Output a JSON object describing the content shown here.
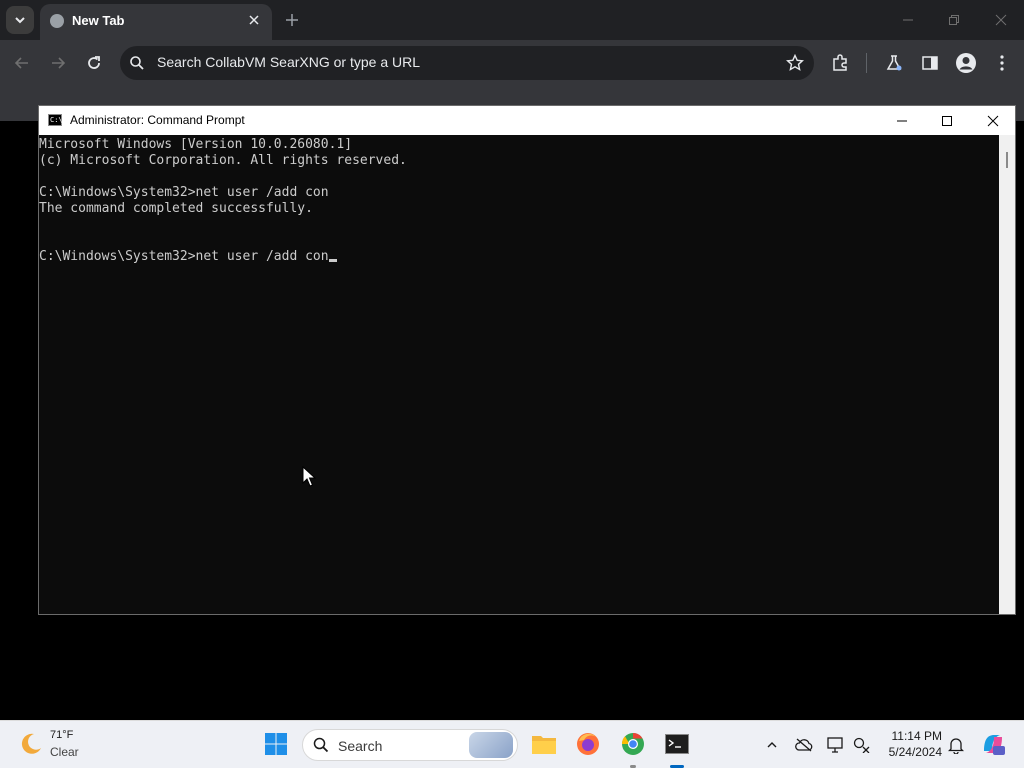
{
  "browser": {
    "tab_title": "New Tab",
    "omnibox_placeholder": "Search CollabVM SearXNG or type a URL"
  },
  "cmd": {
    "title": "Administrator: Command Prompt",
    "icon_text": "C:\\",
    "lines": [
      "Microsoft Windows [Version 10.0.26080.1]",
      "(c) Microsoft Corporation. All rights reserved.",
      "",
      "C:\\Windows\\System32>net user /add con",
      "The command completed successfully.",
      "",
      "",
      "C:\\Windows\\System32>net user /add con"
    ]
  },
  "taskbar": {
    "weather_temp": "71°F",
    "weather_condition": "Clear",
    "search_label": "Search",
    "time": "11:14 PM",
    "date": "5/24/2024"
  },
  "icons": [
    "chevron-down-icon",
    "globe-icon",
    "close-icon",
    "plus-icon",
    "minimize-icon",
    "restore-icon",
    "back-icon",
    "forward-icon",
    "reload-icon",
    "search-icon",
    "star-icon",
    "extensions-icon",
    "labs-icon",
    "side-panel-icon",
    "profile-icon",
    "more-icon",
    "maximize-icon",
    "weather-moon-icon",
    "windows-start-icon",
    "file-explorer-icon",
    "firefox-icon",
    "chrome-icon",
    "terminal-icon",
    "chevron-up-icon",
    "cloud-offline-icon",
    "display-icon",
    "network-icon",
    "bell-icon",
    "copilot-icon",
    "mouse-cursor-icon"
  ],
  "colors": {
    "console_bg": "#0c0c0c",
    "console_text": "#cccccc",
    "chrome_dark": "#35363a",
    "taskbar_bg": "#eef0f5",
    "accent": "#0067c0"
  }
}
